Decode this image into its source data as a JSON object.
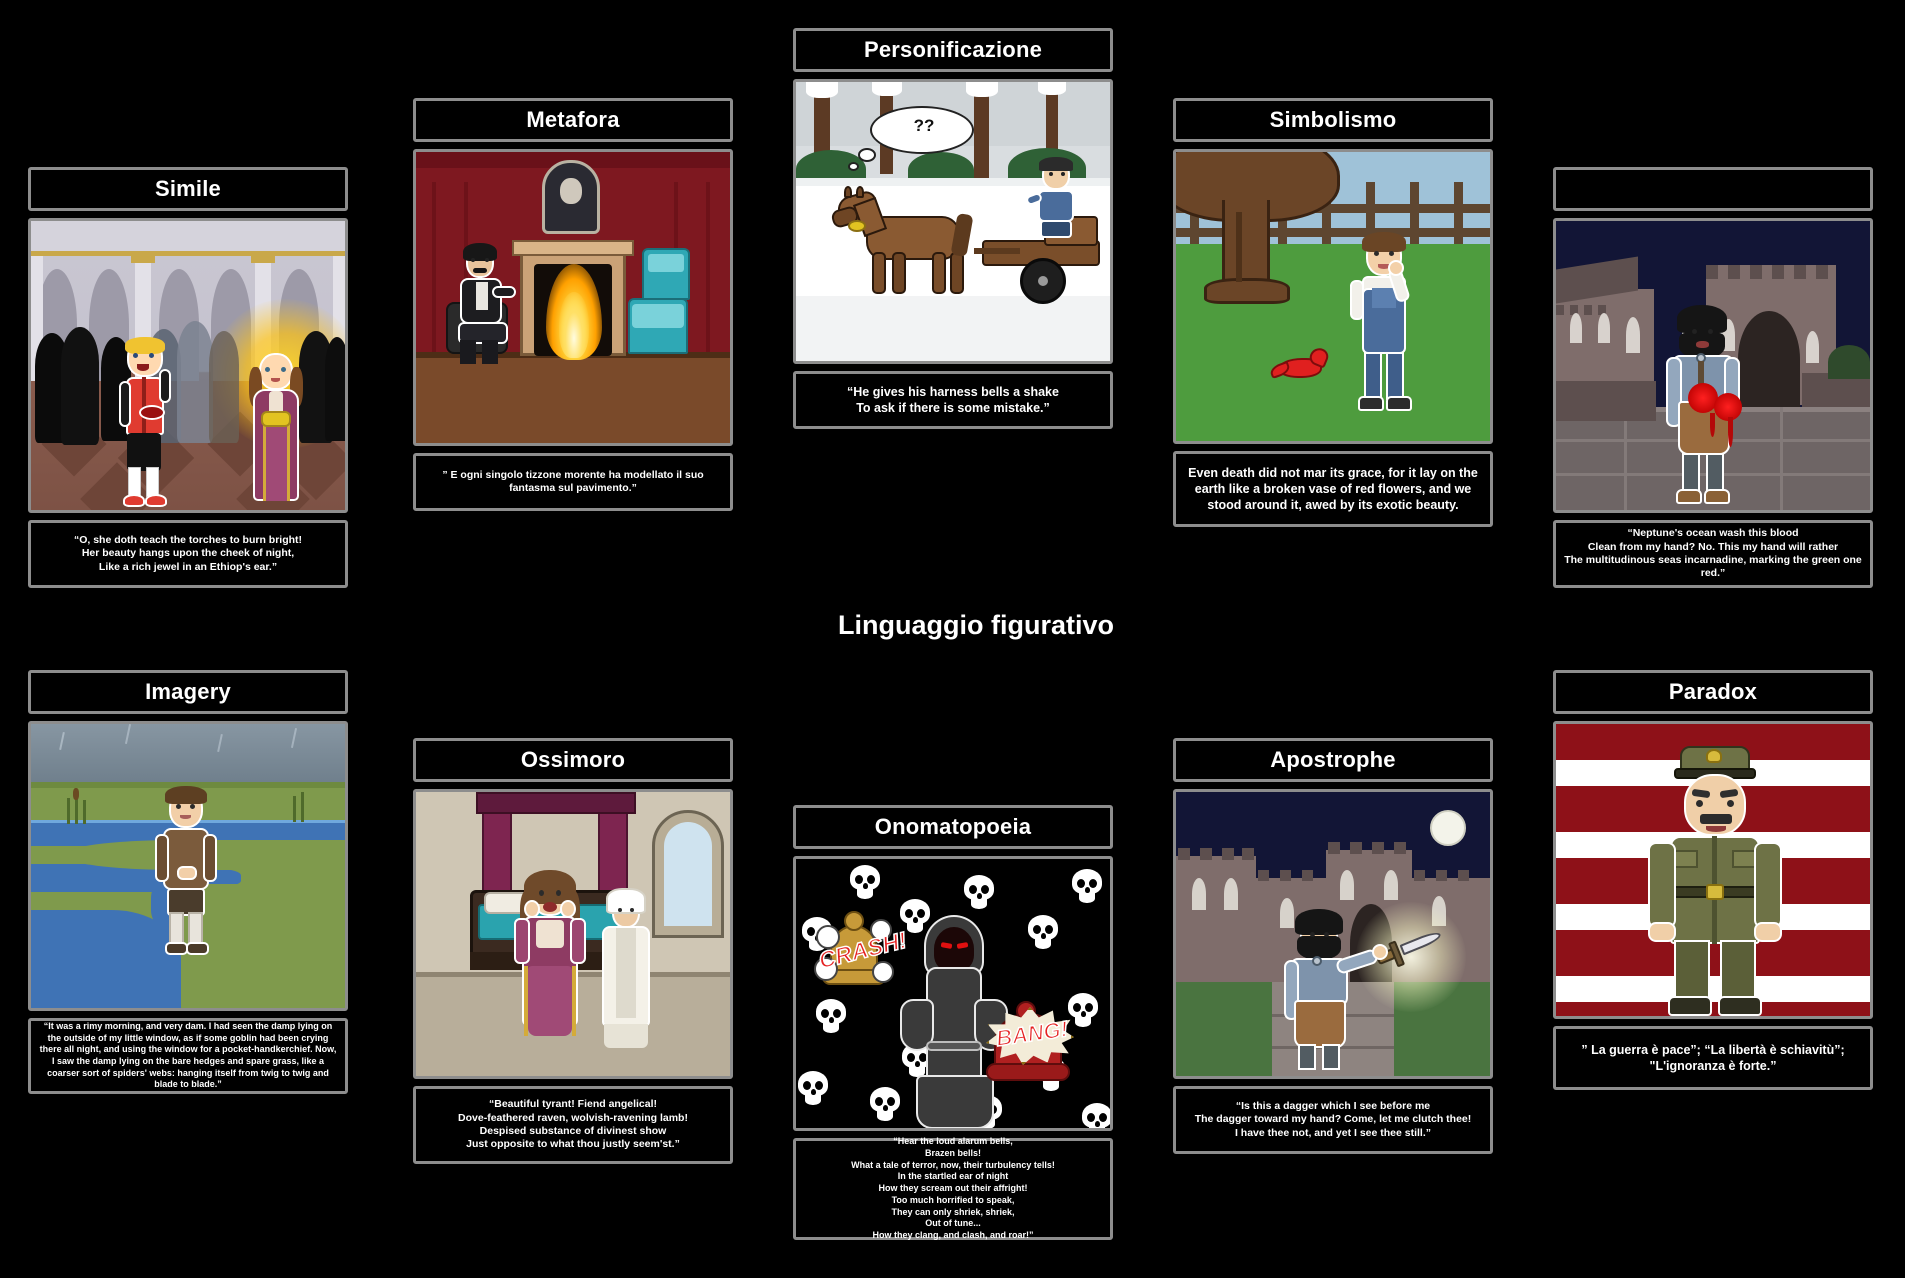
{
  "board": {
    "center_title": "Linguaggio figurativo",
    "background_color": "#000000",
    "frame_border_color": "#8d8d8d",
    "text_color": "#ffffff"
  },
  "panels": [
    {
      "id": "simile",
      "title": "Simile",
      "caption": "“O, she doth teach the torches to burn bright!\nHer beauty hangs upon the cheek of night,\nLike a rich jewel in an Ethiop's ear.”",
      "scene": "ballroom-masquerade",
      "scene_note": "Blond boy in red doublet with red mask facing glowing girl in magenta gown holding gold mask, crowd silhouettes in palace hall"
    },
    {
      "id": "metafora",
      "title": "Metafora",
      "caption": "” E ogni singolo tizzone morente ha modellato il suo fantasma sul pavimento.”",
      "scene": "victorian-parlor-fireplace",
      "scene_note": "Man in black seated beside a blazing fireplace, red damask wallpaper, teal armchairs, portrait above mantel"
    },
    {
      "id": "personificazione",
      "title": "Personificazione",
      "caption": "“He gives his harness bells a shake\nTo ask if there is some mistake.”",
      "scene": "snowy-woods-horse-cart",
      "scene_note": "Horse with harness bells pulling a cart through snowy woods, driver seated, thought bubble with ?? over the horse"
    },
    {
      "id": "simbolismo",
      "title": "Simbolismo",
      "caption": "Even death did not mar its grace, for it lay on the earth like a broken vase of red flowers, and we stood around it, awed by its exotic beauty.",
      "scene": "boy-under-tree-red-bird",
      "scene_note": "Boy in overalls standing on green grass under a large tree, dead red bird on the ground, wooden fence behind"
    },
    {
      "id": "iperbole",
      "title": "",
      "caption": "“Neptune's ocean wash this blood\nClean from my hand? No. This my hand will rather\nThe multitudinous seas incarnadine, marking the green one red.”",
      "scene": "macbeth-bloody-hands-castle",
      "scene_note": "Bearded man in blue cloak with bloody hands, night castle courtyard"
    },
    {
      "id": "imagery",
      "title": "Imagery",
      "caption": "“It was a rimy morning, and very dam. I had seen the damp lying on the outside of my little window, as if some goblin had been crying there all night, and using the window for a pocket-handkerchief. Now, I saw the damp lying on the bare hedges and spare grass, like a coarser sort of spiders' webs: hanging itself from twig to twig and blade to blade.”",
      "scene": "misty-marsh-boy",
      "scene_note": "Boy in brown coat standing on marsh bank beside winding river under grey rainy sky"
    },
    {
      "id": "ossimoro",
      "title": "Ossimoro",
      "caption": "“Beautiful tyrant! Fiend angelical!\nDove-feathered raven, wolvish-ravening lamb!\nDespised substance of divinest show\nJust opposite to what thou justly seem'st.”",
      "scene": "juliet-bedchamber-nurse",
      "scene_note": "Distressed girl in magenta gown hands to face, nurse in white behind, canopy bed with teal quilt"
    },
    {
      "id": "onomatopoeia",
      "title": "Onomatopoeia",
      "caption": "“Hear the loud alarum bells,\nBrazen bells!\nWhat a tale of terror, now, their turbulency tells!\nIn the startled ear of night\nHow they scream out their affright!\nToo much horrified to speak,\nThey can only shriek, shriek,\nOut of tune...\nHow they clang, and clash, and roar!”",
      "scene": "reaper-with-bells",
      "scene_note": "Hooded reaper with red eyes between two clanging bells on a black field of white skulls",
      "sfx": [
        "CRASH!",
        "BANG!"
      ]
    },
    {
      "id": "apostrophe",
      "title": "Apostrophe",
      "caption": "“Is this a dagger which I see before me\nThe dagger toward my hand? Come, let me clutch thee!\nI have thee not, and yet I see thee still.”",
      "scene": "macbeth-floating-dagger",
      "scene_note": "Bearded man reaching toward a glowing floating dagger in a moonlit castle courtyard"
    },
    {
      "id": "paradox",
      "title": "Paradox",
      "caption": "” La guerra è pace”; “La libertà è schiavitù”;\n\"L'ignoranza è forte.”",
      "scene": "big-brother-officer-flag",
      "scene_note": "Stern officer in olive uniform and peaked cap in front of a red banner with white stripes"
    }
  ]
}
